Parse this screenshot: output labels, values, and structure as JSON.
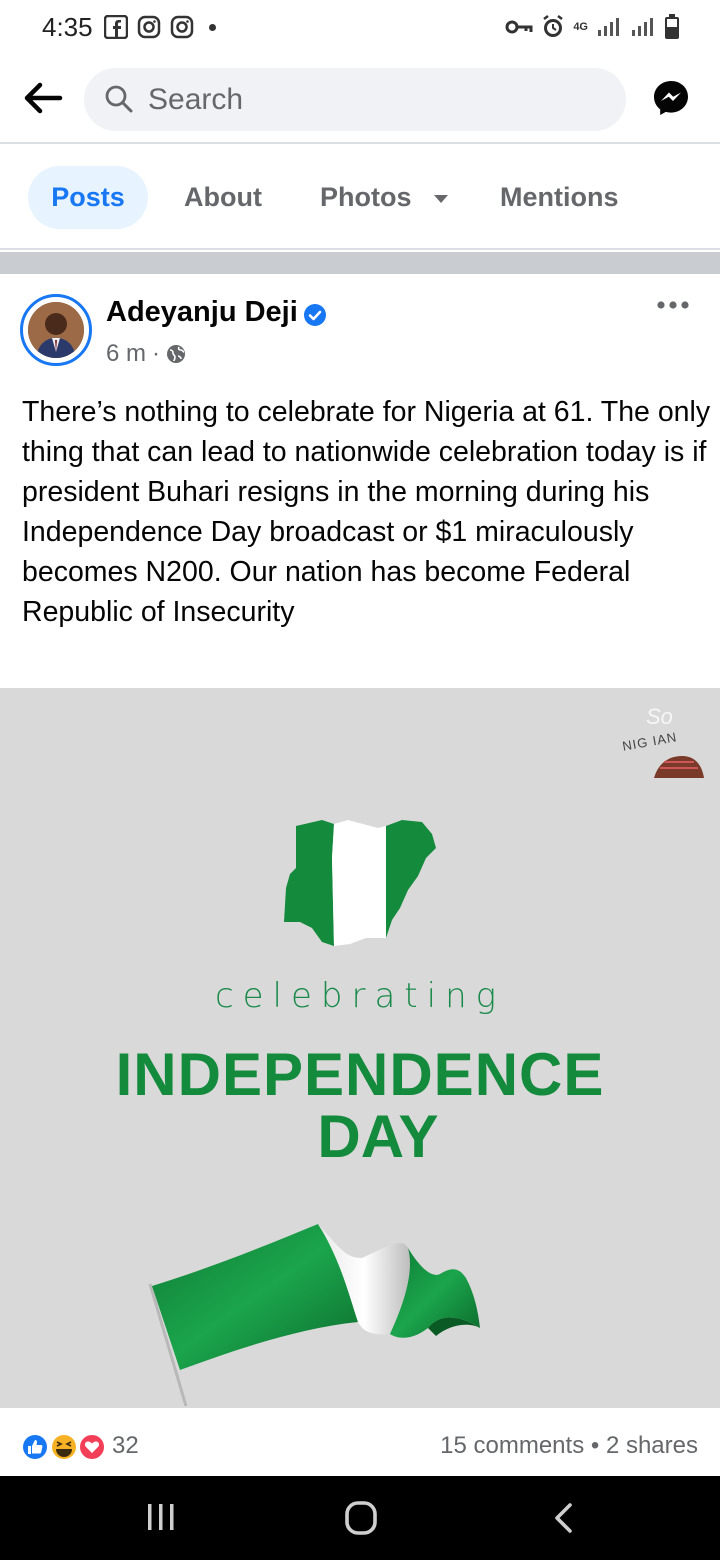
{
  "status_bar": {
    "time": "4:35",
    "network": "4G"
  },
  "search": {
    "placeholder": "Search"
  },
  "tabs": [
    {
      "label": "Posts",
      "active": true
    },
    {
      "label": "About"
    },
    {
      "label": "Photos"
    },
    {
      "label": "Mentions"
    }
  ],
  "post": {
    "author": "Adeyanju Deji",
    "time": "6 m",
    "separator": "·",
    "text": "There’s nothing to celebrate for Nigeria at 61. The only thing that can lead to nationwide celebration today is if president Buhari resigns in the morning during his Independence Day broadcast or $1 miraculously becomes N200. Our nation has become Federal Republic of Insecurity",
    "image": {
      "line1": "celebrating",
      "line2": "INDEPENDENCE",
      "line3": "DAY",
      "watermark_top": "So",
      "watermark_bottom": "NIG IAN"
    },
    "reactions_count": "32",
    "comments_shares": "15 comments • 2 shares"
  },
  "colors": {
    "accent": "#1877f2",
    "flag_green": "#138a3c",
    "image_bg": "#d9d9d9"
  },
  "icons": [
    "facebook-icon",
    "instagram-icon",
    "instagram-icon",
    "key-icon",
    "alarm-icon",
    "signal-icon",
    "battery-icon",
    "back-arrow-icon",
    "search-icon",
    "messenger-icon",
    "verified-icon",
    "globe-icon",
    "more-icon",
    "like-reaction-icon",
    "haha-reaction-icon",
    "love-reaction-icon",
    "recent-apps-icon",
    "home-icon",
    "nav-back-icon"
  ]
}
